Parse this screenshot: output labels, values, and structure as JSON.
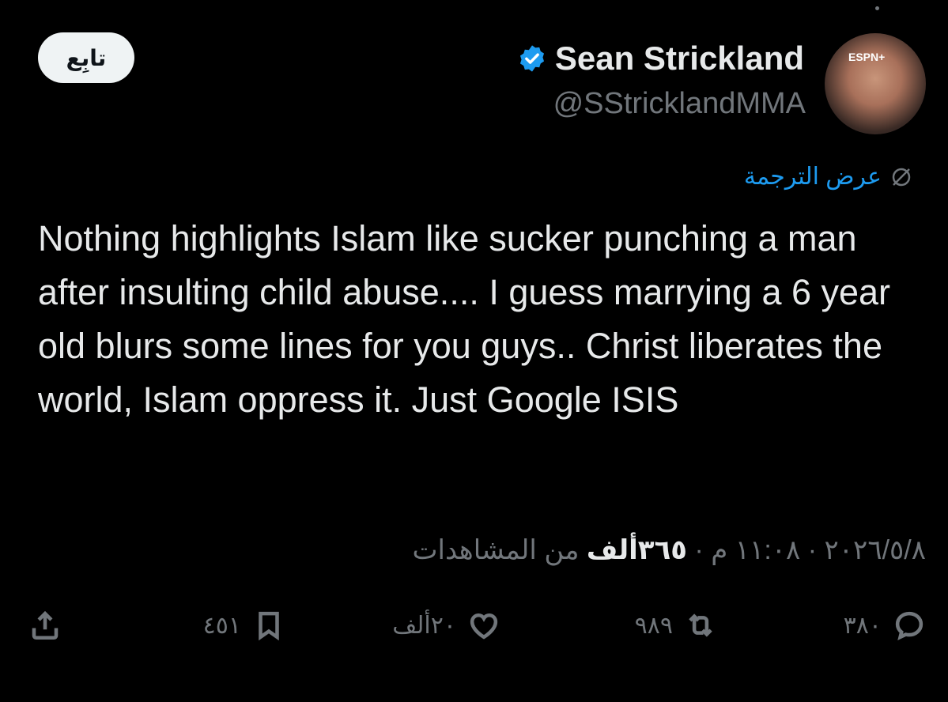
{
  "author": {
    "display_name": "Sean Strickland",
    "handle": "@SStricklandMMA",
    "verified_color": "#1d9bf0",
    "avatar_badge": "ESPN+"
  },
  "follow_button": {
    "label": "تابِع"
  },
  "translate_link": {
    "label": "عرض الترجمة",
    "icon": "translate-icon"
  },
  "tweet": {
    "text": "Nothing highlights Islam like sucker punching a man after insulting child abuse.... I guess marrying a 6 year old blurs some lines for you guys.. Christ liberates the world, Islam oppress it. Just Google ISIS"
  },
  "meta": {
    "date": "٢٠٢٦/٥/٨",
    "time": "١١:٠٨ م",
    "views_count": "٣٦٥ألف",
    "views_label": "من المشاهدات"
  },
  "actions": {
    "replies": {
      "count": "٣٨٠",
      "icon": "reply-icon"
    },
    "retweets": {
      "count": "٩٨٩",
      "icon": "retweet-icon"
    },
    "likes": {
      "count": "٢٠ألف",
      "icon": "heart-icon"
    },
    "bookmarks": {
      "count": "٤٥١",
      "icon": "bookmark-icon"
    },
    "share": {
      "icon": "share-icon"
    }
  },
  "colors": {
    "background": "#000000",
    "text": "#e7e9ea",
    "muted": "#71767b",
    "accent": "#1d9bf0"
  }
}
